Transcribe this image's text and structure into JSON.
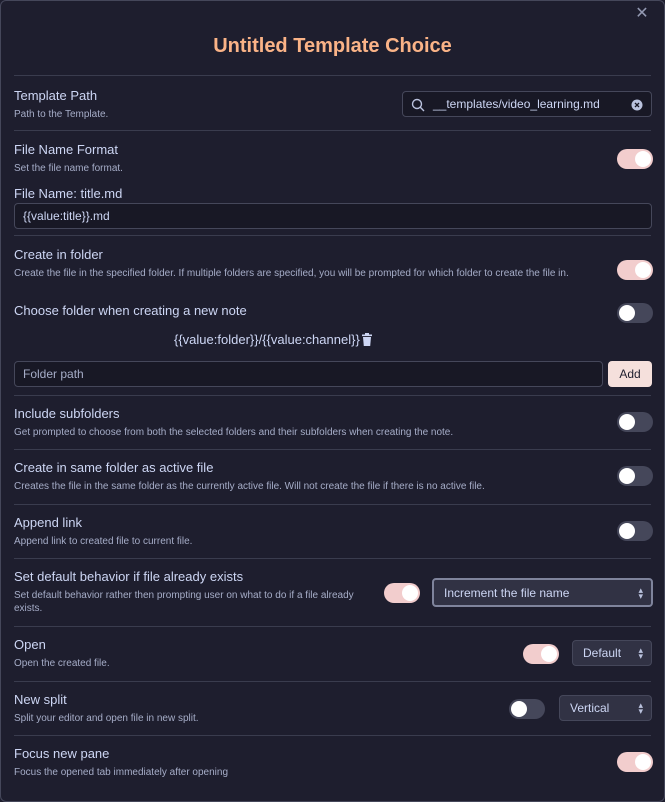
{
  "dialog": {
    "title": "Untitled Template Choice",
    "close_icon": "close-icon"
  },
  "template_path": {
    "name": "Template Path",
    "desc": "Path to the Template.",
    "value": "__templates/video_learning.md"
  },
  "file_name_format": {
    "name": "File Name Format",
    "desc": "Set the file name format.",
    "enabled": true,
    "preview_label": "File Name: title.md",
    "value": "{{value:title}}.md"
  },
  "create_in_folder": {
    "name": "Create in folder",
    "desc": "Create the file in the specified folder. If multiple folders are specified, you will be prompted for which folder to create the file in.",
    "enabled": true
  },
  "choose_folder": {
    "name": "Choose folder when creating a new note",
    "enabled": false,
    "folder_entry": "{{value:folder}}/{{value:channel}}",
    "folder_path_placeholder": "Folder path",
    "add_label": "Add"
  },
  "include_subfolders": {
    "name": "Include subfolders",
    "desc": "Get prompted to choose from both the selected folders and their subfolders when creating the note.",
    "enabled": false
  },
  "same_folder": {
    "name": "Create in same folder as active file",
    "desc": "Creates the file in the same folder as the currently active file. Will not create the file if there is no active file.",
    "enabled": false
  },
  "append_link": {
    "name": "Append link",
    "desc": "Append link to created file to current file.",
    "enabled": false
  },
  "default_behavior": {
    "name": "Set default behavior if file already exists",
    "desc": "Set default behavior rather then prompting user on what to do if a file already exists.",
    "enabled": true,
    "selected": "Increment the file name"
  },
  "open": {
    "name": "Open",
    "desc": "Open the created file.",
    "enabled": true,
    "selected": "Default"
  },
  "new_split": {
    "name": "New split",
    "desc": "Split your editor and open file in new split.",
    "enabled": false,
    "selected": "Vertical"
  },
  "focus_new_pane": {
    "name": "Focus new pane",
    "desc": "Focus the opened tab immediately after opening",
    "enabled": true
  },
  "colors": {
    "accent": "#fab387",
    "toggle_on": "#f2cdcd",
    "background": "#1e1e2e"
  }
}
